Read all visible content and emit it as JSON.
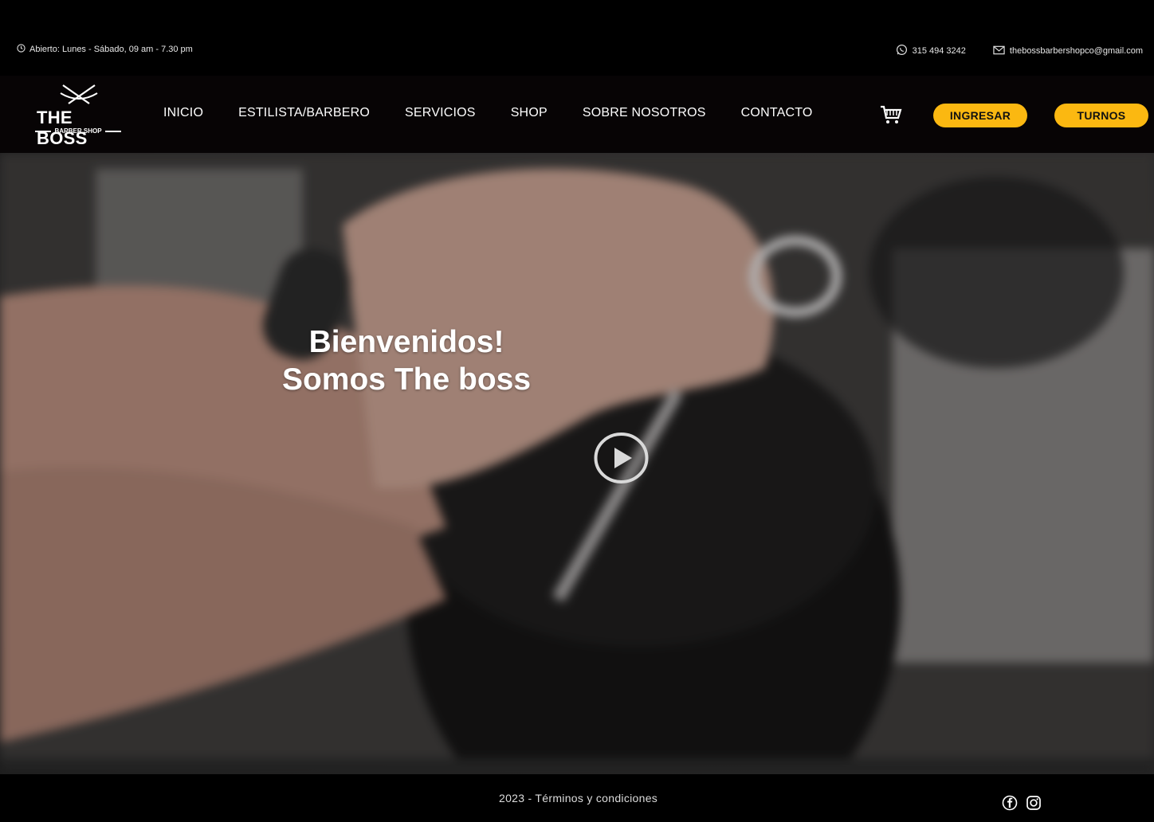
{
  "topbar": {
    "hours": "Abierto: Lunes - Sábado, 09 am - 7.30 pm",
    "phone": "315 494 3242",
    "email": "thebossbarbershopco@gmail.com"
  },
  "brand": {
    "name": "THE BOSS",
    "tagline": "BARBER SHOP"
  },
  "nav": {
    "items": [
      "INICIO",
      "ESTILISTA/BARBERO",
      "SERVICIOS",
      "SHOP",
      "SOBRE NOSOTROS",
      "CONTACTO"
    ]
  },
  "actions": {
    "login_label": "INGRESAR",
    "turnos_label": "TURNOS"
  },
  "hero": {
    "line1": "Bienvenidos!",
    "line2": "Somos The boss"
  },
  "footer": {
    "copyright": "2023 - Términos y condiciones"
  },
  "icons": {
    "clock": "clock-icon",
    "whatsapp": "whatsapp-icon",
    "mail": "mail-icon",
    "cart": "cart-icon",
    "play": "play-icon",
    "facebook": "facebook-icon",
    "instagram": "instagram-icon",
    "scissors": "scissors-icon"
  },
  "colors": {
    "accent": "#fbb811",
    "nav_bg": "#070405",
    "top_bg": "#000000"
  }
}
